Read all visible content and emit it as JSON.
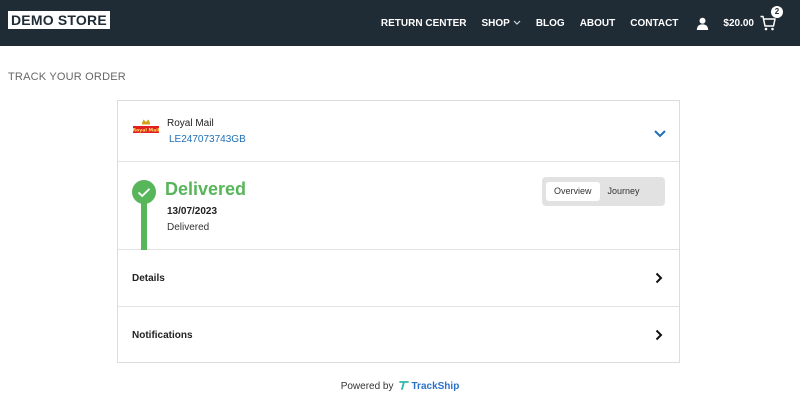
{
  "header": {
    "logo": "DEMO STORE",
    "nav": {
      "return_center": "RETURN CENTER",
      "shop": "SHOP",
      "blog": "BLOG",
      "about": "ABOUT",
      "contact": "CONTACT"
    },
    "cart_total": "$20.00",
    "cart_count": "2"
  },
  "page": {
    "title": "TRACK YOUR ORDER"
  },
  "shipment": {
    "provider_name": "Royal Mail",
    "provider_logo_text": "Royal Mail",
    "tracking_number": "LE247073743GB",
    "status_title": "Delivered",
    "status_date": "13/07/2023",
    "status_text": "Delivered",
    "view_toggle": {
      "overview": "Overview",
      "journey": "Journey",
      "selected": "Overview"
    },
    "details_label": "Details",
    "notifications_label": "Notifications"
  },
  "footer": {
    "powered_by": "Powered by",
    "brand": "TrackShip"
  },
  "colors": {
    "header_bg": "#1f2b35",
    "status_green": "#57b55a",
    "link_blue": "#1f6fb5",
    "brand_blue": "#2a71c9"
  }
}
